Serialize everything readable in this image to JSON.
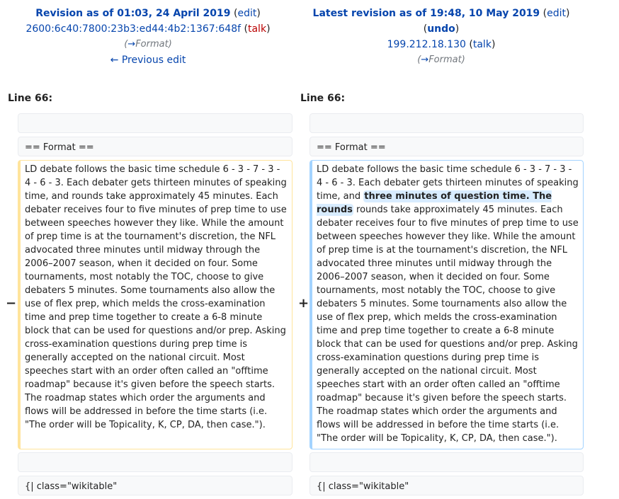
{
  "left": {
    "title_prefix": "Revision as of 01:03, 24 April 2019",
    "edit_label": "edit",
    "user": "2600:6c40:7800:23b3:ed44:4b2:1367:648f",
    "talk_label": "talk",
    "summary_arrow": "→",
    "summary_text": "Format",
    "prev_label": "← Previous edit",
    "line_label": "Line 66:",
    "heading_line": "== Format ==",
    "paragraph": "LD debate follows the basic time schedule 6 - 3 - 7 - 3 - 4 - 6 - 3. Each debater gets thirteen minutes of speaking time, and rounds take approximately 45 minutes. Each debater receives four to five minutes of prep time to use between speeches however they like. While the amount of prep time is at the tournament's discretion, the NFL advocated three minutes until midway through the 2006–2007 season, when it decided on four. Some tournaments, most notably the TOC, choose to give debaters 5 minutes. Some tournaments also allow the use of flex prep, which melds the cross-examination time and prep time together to create a 6-8 minute block that can be used for questions and/or prep. Asking cross-examination questions during prep time is generally accepted on the national circuit. Most speeches start with an order often called an \"offtime roadmap\" because it's given before the speech starts. The roadmap states which order the arguments and flows will be addressed in before the time starts (i.e. \"The order will be Topicality, K, CP, DA, then case.\").",
    "table_line": "{| class=\"wikitable\"",
    "marker": "−"
  },
  "right": {
    "title_prefix": "Latest revision as of 19:48, 10 May 2019",
    "edit_label": "edit",
    "undo_label": "undo",
    "user": "199.212.18.130",
    "talk_label": "talk",
    "summary_arrow": "→",
    "summary_text": "Format",
    "line_label": "Line 66:",
    "heading_line": "== Format ==",
    "para_start": "LD debate follows the basic time schedule 6 - 3 - 7 - 3 - 4 - 6 - 3. Each debater gets thirteen minutes of speaking time, and ",
    "para_inserted": "three minutes of question time. The rounds",
    "para_rest": " rounds take approximately 45 minutes. Each debater receives four to five minutes of prep time to use between speeches however they like. While the amount of prep time is at the tournament's discretion, the NFL advocated three minutes until midway through the 2006–2007 season, when it decided on four. Some tournaments, most notably the TOC, choose to give debaters 5 minutes. Some tournaments also allow the use of flex prep, which melds the cross-examination time and prep time together to create a 6-8 minute block that can be used for questions and/or prep. Asking cross-examination questions during prep time is generally accepted on the national circuit. Most speeches start with an order often called an \"offtime roadmap\" because it's given before the speech starts. The roadmap states which order the arguments and flows will be addressed in before the time starts (i.e. \"The order will be Topicality, K, CP, DA, then case.\").",
    "table_line": "{| class=\"wikitable\"",
    "marker": "+"
  },
  "colors": {
    "link": "#0645ad",
    "deleted_border": "#ffe49c",
    "added_border": "#a3d3ff",
    "added_highlight": "#d8ecff",
    "context_bg": "#f8f9fa"
  }
}
